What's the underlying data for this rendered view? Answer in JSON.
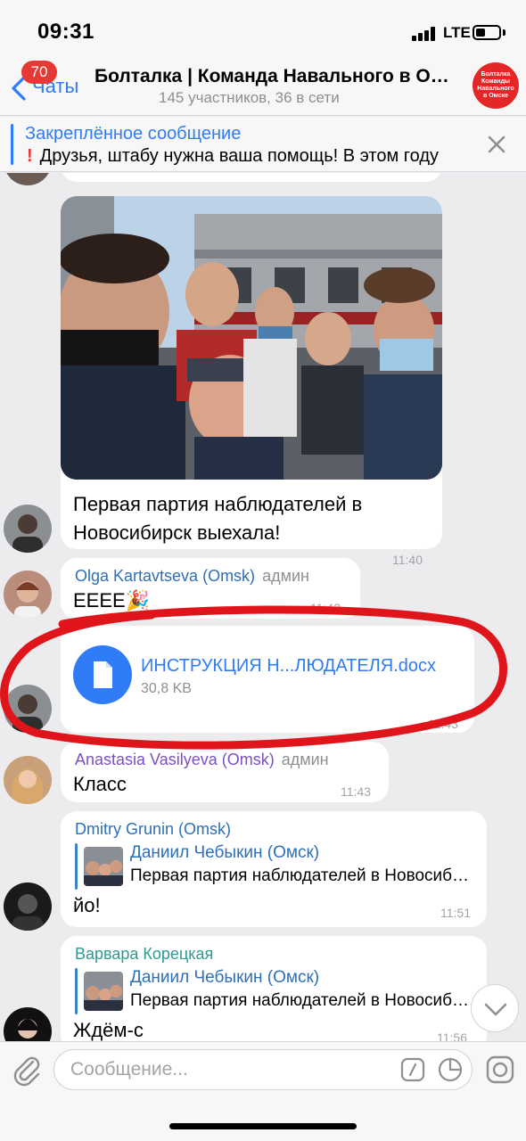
{
  "status": {
    "time": "09:31",
    "network": "LTE"
  },
  "header": {
    "back_label": "Чаты",
    "unread_badge": "70",
    "title": "Болталка | Команда Навального в Омске",
    "subtitle": "145 участников, 36 в сети",
    "avatar_text": "Болталка Команды Навального в Омске"
  },
  "pinned": {
    "title": "Закреплённое сообщение",
    "text": "Друзья, штабу нужна ваша помощь! В этом году"
  },
  "messages": [
    {
      "type": "photo",
      "text": "Первая партия наблюдателей в Новосибирск выехала!",
      "time": "11:40"
    },
    {
      "sender": "Olga Kartavtseva (Omsk)",
      "role": "админ",
      "text": "ЕЕЕЕ🎉",
      "time": "11:42"
    },
    {
      "type": "file",
      "file_name": "ИНСТРУКЦИЯ Н...ЛЮДАТЕЛЯ.docx",
      "file_size": "30,8 KB",
      "time": "11:43"
    },
    {
      "sender": "Anastasia Vasilyeva (Omsk)",
      "role": "админ",
      "text": "Класс",
      "time": "11:43"
    },
    {
      "sender": "Dmitry Grunin (Omsk)",
      "reply_name": "Даниил Чебыкин (Омск)",
      "reply_text": "Первая партия наблюдателей в Новосибирск выехала!",
      "text": "йо!",
      "time": "11:51"
    },
    {
      "sender": "Варвара Корецкая",
      "reply_name": "Даниил Чебыкин (Омск)",
      "reply_text": "Первая партия наблюдателей в Новосибирск выехала!",
      "text": "Ждём-с",
      "time": "11:56"
    }
  ],
  "input": {
    "placeholder": "Сообщение..."
  },
  "colors": {
    "accent": "#2f7cf6",
    "badge": "#e53935",
    "annotation": "#e0151c",
    "bubble": "#ffffff"
  },
  "icons": [
    "back-chevron-icon",
    "close-icon",
    "document-icon",
    "paperclip-icon",
    "slash-command-icon",
    "sticker-icon",
    "camera-icon",
    "chevron-down-icon"
  ]
}
